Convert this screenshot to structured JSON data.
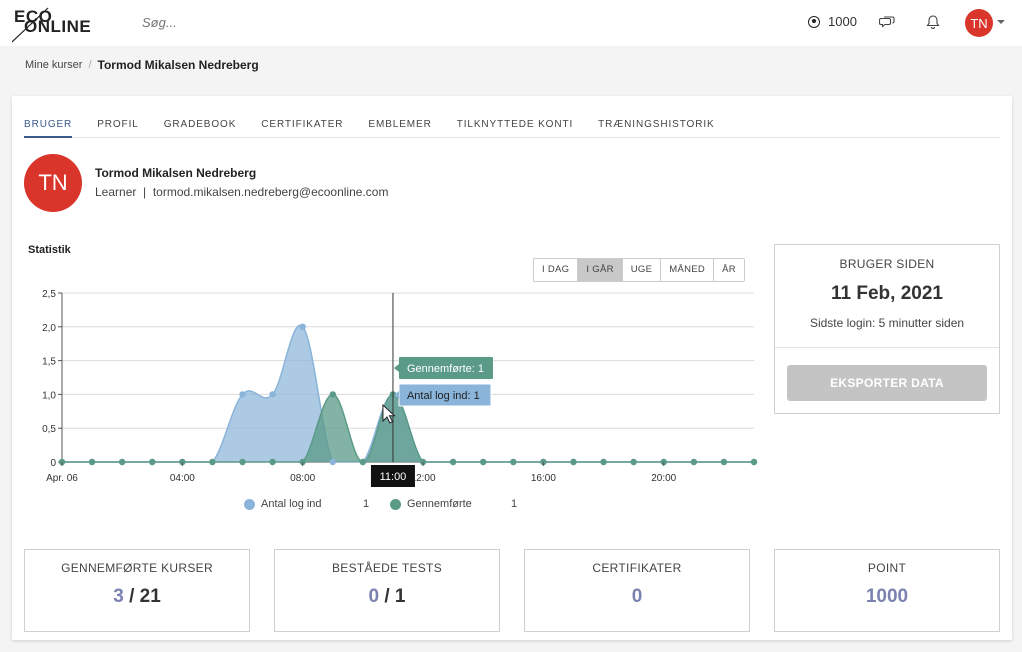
{
  "header": {
    "logo_line1": "ECO",
    "logo_line2": "ONLINE",
    "search_placeholder": "Søg...",
    "points": "1000",
    "avatar_initials": "TN"
  },
  "breadcrumb": {
    "parent": "Mine kurser",
    "separator": "/",
    "current": "Tormod Mikalsen Nedreberg"
  },
  "tabs": [
    {
      "label": "BRUGER",
      "active": true
    },
    {
      "label": "PROFIL",
      "active": false
    },
    {
      "label": "GRADEBOOK",
      "active": false
    },
    {
      "label": "CERTIFIKATER",
      "active": false
    },
    {
      "label": "EMBLEMER",
      "active": false
    },
    {
      "label": "TILKNYTTEDE KONTI",
      "active": false
    },
    {
      "label": "TRÆNINGSHISTORIK",
      "active": false
    }
  ],
  "user": {
    "initials": "TN",
    "name": "Tormod Mikalsen Nedreberg",
    "role_line": "Learner  |  tormod.mikalsen.nedreberg@ecoonline.com"
  },
  "statistics": {
    "title": "Statistik",
    "ranges": [
      "I DAG",
      "I GÅR",
      "UGE",
      "MÅNED",
      "ÅR"
    ],
    "selected_range": "I GÅR",
    "legend": [
      {
        "name": "Antal log ind",
        "value": "1"
      },
      {
        "name": "Gennemførte",
        "value": "1"
      }
    ],
    "tooltip_completed": "Gennemførte: 1",
    "tooltip_logins": "Antal log ind: 1",
    "crosshair_label": "11:00"
  },
  "chart_data": {
    "type": "area",
    "x": [
      "00:00",
      "01:00",
      "02:00",
      "03:00",
      "04:00",
      "05:00",
      "06:00",
      "07:00",
      "08:00",
      "09:00",
      "10:00",
      "11:00",
      "12:00",
      "13:00",
      "14:00",
      "15:00",
      "16:00",
      "17:00",
      "18:00",
      "19:00",
      "20:00",
      "21:00",
      "22:00",
      "23:00"
    ],
    "x_tick_labels": [
      "Apr. 06",
      "04:00",
      "08:00",
      "12:00",
      "16:00",
      "20:00"
    ],
    "y_tick_labels": [
      "0",
      "0,5",
      "1,0",
      "1,5",
      "2,0",
      "2,5"
    ],
    "ylim": [
      0,
      2.5
    ],
    "series": [
      {
        "name": "Antal log ind",
        "color": "#8ab4d9",
        "values": [
          0,
          0,
          0,
          0,
          0,
          0,
          1,
          1,
          2,
          0,
          0,
          1,
          0,
          0,
          0,
          0,
          0,
          0,
          0,
          0,
          0,
          0,
          0,
          0
        ]
      },
      {
        "name": "Gennemførte",
        "color": "#5a9a87",
        "values": [
          0,
          0,
          0,
          0,
          0,
          0,
          0,
          0,
          0,
          1,
          0,
          1,
          0,
          0,
          0,
          0,
          0,
          0,
          0,
          0,
          0,
          0,
          0,
          0
        ]
      }
    ],
    "grid": true,
    "legend_position": "bottom"
  },
  "member_since": {
    "label": "BRUGER SIDEN",
    "date": "11 Feb, 2021",
    "last_login": "Sidste login: 5 minutter siden",
    "export_label": "EKSPORTER DATA"
  },
  "stats": [
    {
      "label": "GENNEMFØRTE KURSER",
      "num": "3",
      "rest": " / 21"
    },
    {
      "label": "BESTÅEDE TESTS",
      "num": "0",
      "rest": " / 1"
    },
    {
      "label": "CERTIFIKATER",
      "num": "0",
      "rest": ""
    },
    {
      "label": "POINT",
      "num": "1000",
      "rest": ""
    }
  ],
  "colors": {
    "accent": "#3a5a8a",
    "avatar": "#d9352a",
    "stat_number": "#7c82b0",
    "logins": "#8ab4d9",
    "completed": "#5a9a87"
  }
}
